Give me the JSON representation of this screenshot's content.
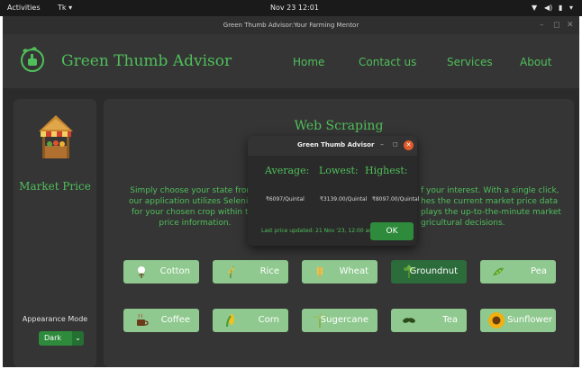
{
  "topbar": {
    "activities": "Activities",
    "keyboard": "Tk ▾",
    "clock": "Nov 23  12:01"
  },
  "window": {
    "title": "Green Thumb Advisor:Your Farming Mentor"
  },
  "header": {
    "brand": "Green Thumb Advisor",
    "nav": [
      "Home",
      "Contact us",
      "Services",
      "About"
    ]
  },
  "sidebar": {
    "title": "Market Price",
    "mode_label": "Appearance Mode",
    "mode_value": "Dark"
  },
  "main": {
    "title": "Web Scraping",
    "desc_left": [
      "Simply choose your state from t",
      "our application utilizes Selenium",
      "for your chosen crop within the",
      "price information."
    ],
    "desc_right": [
      "f your interest. With a single click,",
      "hes the current market price data",
      "plays the up-to-the-minute market",
      "gricultural decisions."
    ]
  },
  "crops": [
    {
      "label": "Cotton",
      "icon": "cotton-icon"
    },
    {
      "label": "Rice",
      "icon": "rice-icon"
    },
    {
      "label": "Wheat",
      "icon": "wheat-icon"
    },
    {
      "label": "Groundnut",
      "icon": "groundnut-icon"
    },
    {
      "label": "Pea",
      "icon": "pea-icon"
    },
    {
      "label": "Coffee",
      "icon": "coffee-icon"
    },
    {
      "label": "Corn",
      "icon": "corn-icon"
    },
    {
      "label": "Sugercane",
      "icon": "sugarcane-icon"
    },
    {
      "label": "Tea",
      "icon": "tea-icon"
    },
    {
      "label": "Sunflower",
      "icon": "sunflower-icon"
    }
  ],
  "selected_crop": "Groundnut",
  "dialog": {
    "title": "Green Thumb Advisor",
    "headers": [
      "Average:",
      "Lowest:",
      "Highest:"
    ],
    "values": [
      "₹6097/Quintal",
      "₹3139.00/Quintal",
      "₹8097.00/Quintal"
    ],
    "footer": "Last price updated: 21 Nov '23, 12:00 am",
    "ok": "OK"
  },
  "colors": {
    "accent": "#4fbf5a",
    "crop_button": "#8fc98f",
    "crop_selected": "#2c6b3a",
    "bg": "#2b2b2b",
    "panel": "#353535"
  }
}
